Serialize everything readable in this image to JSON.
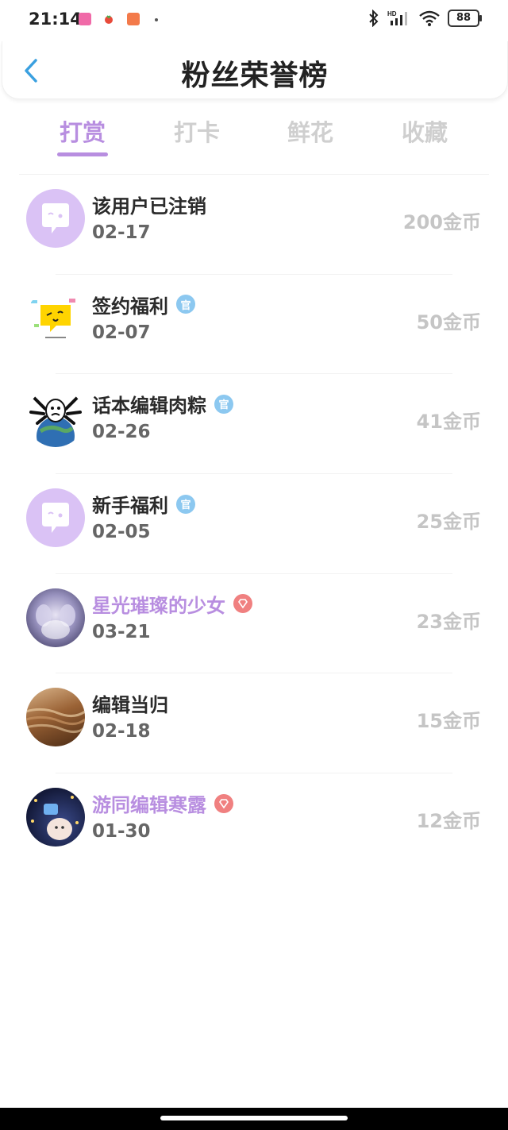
{
  "status": {
    "time": "21:14",
    "battery": "88"
  },
  "header": {
    "title": "粉丝荣誉榜"
  },
  "tabs": [
    {
      "label": "打赏",
      "active": true
    },
    {
      "label": "打卡",
      "active": false
    },
    {
      "label": "鲜花",
      "active": false
    },
    {
      "label": "收藏",
      "active": false
    }
  ],
  "rows": [
    {
      "name": "该用户已注销",
      "date": "02-17",
      "amount": "200金币",
      "badge": "none",
      "vip": false
    },
    {
      "name": "签约福利",
      "date": "02-07",
      "amount": "50金币",
      "badge": "official",
      "vip": false
    },
    {
      "name": "话本编辑肉粽",
      "date": "02-26",
      "amount": "41金币",
      "badge": "official",
      "vip": false
    },
    {
      "name": "新手福利",
      "date": "02-05",
      "amount": "25金币",
      "badge": "official",
      "vip": false
    },
    {
      "name": "星光璀璨的少女",
      "date": "03-21",
      "amount": "23金币",
      "badge": "diamond",
      "vip": true
    },
    {
      "name": "编辑当归",
      "date": "02-18",
      "amount": "15金币",
      "badge": "none",
      "vip": false
    },
    {
      "name": "游同编辑寒露",
      "date": "01-30",
      "amount": "12金币",
      "badge": "diamond",
      "vip": true
    }
  ],
  "badges": {
    "official_text": "官"
  },
  "colors": {
    "accent": "#b88ee0",
    "official": "#8cc8f0",
    "diamond": "#f08080"
  }
}
